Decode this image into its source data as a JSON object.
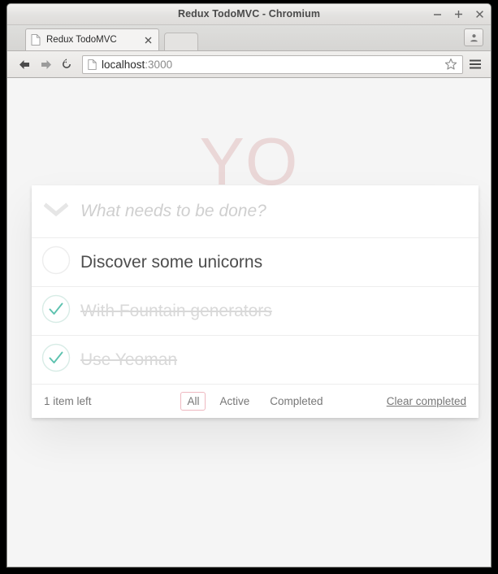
{
  "window": {
    "title": "Redux TodoMVC - Chromium",
    "controls": {
      "minimize": "minimize-button",
      "maximize": "maximize-button",
      "close": "close-button"
    }
  },
  "tabs": [
    {
      "title": "Redux TodoMVC",
      "favicon": "page-icon",
      "close": "close-tab-icon"
    }
  ],
  "toolbar": {
    "back": "back-arrow-icon",
    "forward": "forward-arrow-icon",
    "reload": "reload-icon",
    "url_favicon": "page-icon",
    "url_host": "localhost",
    "url_port": ":3000",
    "url_full": "localhost:3000",
    "bookmark": "star-icon",
    "menu": "hamburger-menu-icon",
    "profile": "user-profile-icon"
  },
  "app": {
    "title": "YO",
    "title_color": "#ead7d7",
    "accent_color": "#eeb8c0",
    "check_color": "#5dc2af",
    "new_todo_placeholder": "What needs to be done?",
    "toggle_all_icon": "chevron-down-icon",
    "todos": [
      {
        "text": "Discover some unicorns",
        "completed": false
      },
      {
        "text": "With Fountain generators",
        "completed": true
      },
      {
        "text": "Use Yeoman",
        "completed": true
      }
    ],
    "footer": {
      "count_text": "1 item left",
      "filters": [
        {
          "label": "All",
          "selected": true
        },
        {
          "label": "Active",
          "selected": false
        },
        {
          "label": "Completed",
          "selected": false
        }
      ],
      "clear_completed": "Clear completed"
    }
  }
}
